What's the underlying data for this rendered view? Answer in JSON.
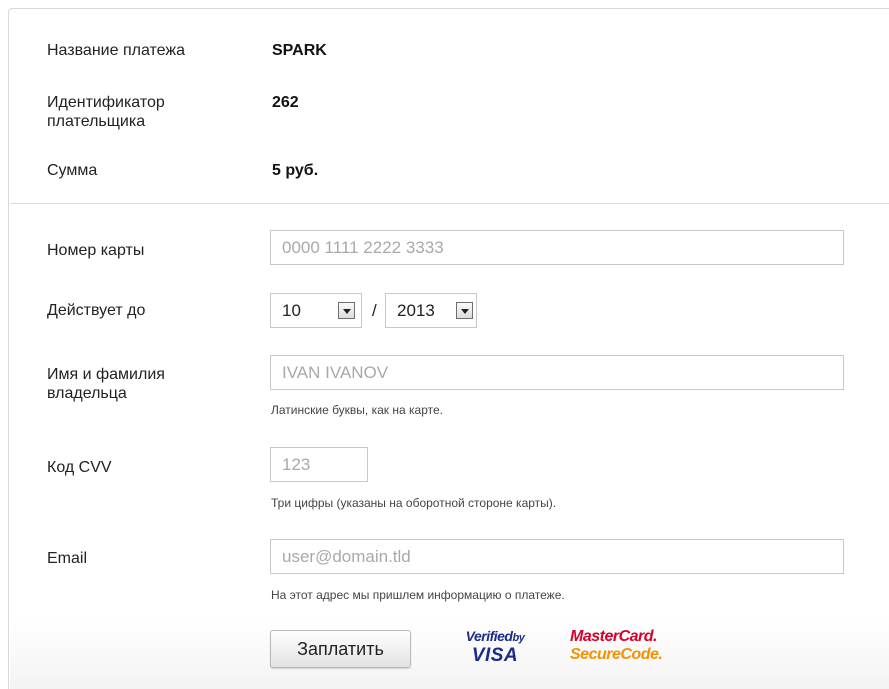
{
  "summary": {
    "payment_name_label": "Название платежа",
    "payment_name_value": "SPARK",
    "payer_id_label_line1": "Идентификатор",
    "payer_id_label_line2": "плательщика",
    "payer_id_value": "262",
    "amount_label": "Сумма",
    "amount_value": "5 руб."
  },
  "form": {
    "card_number_label": "Номер карты",
    "card_number_placeholder": "0000 1111 2222 3333",
    "card_number_value": "",
    "expiry_label": "Действует до",
    "expiry_month": "10",
    "expiry_separator": "/",
    "expiry_year": "2013",
    "holder_label_line1": "Имя и фамилия",
    "holder_label_line2": "владельца",
    "holder_placeholder": "IVAN IVANOV",
    "holder_value": "",
    "holder_hint": "Латинские буквы, как на карте.",
    "cvv_label": "Код CVV",
    "cvv_placeholder": "123",
    "cvv_value": "",
    "cvv_hint": "Три цифры (указаны на оборотной стороне карты).",
    "email_label": "Email",
    "email_placeholder": "user@domain.tld",
    "email_value": "",
    "email_hint": "На этот адрес мы пришлем информацию о платеже.",
    "pay_button_label": "Заплатить"
  },
  "logos": {
    "visa_line1": "Verified",
    "visa_by": "by",
    "visa_line2": "VISA",
    "mc_line1": "MasterCard.",
    "mc_line2": "SecureCode.",
    "visa_color": "#1a2c8a",
    "mc_red": "#d8002a",
    "mc_orange": "#f39200"
  }
}
